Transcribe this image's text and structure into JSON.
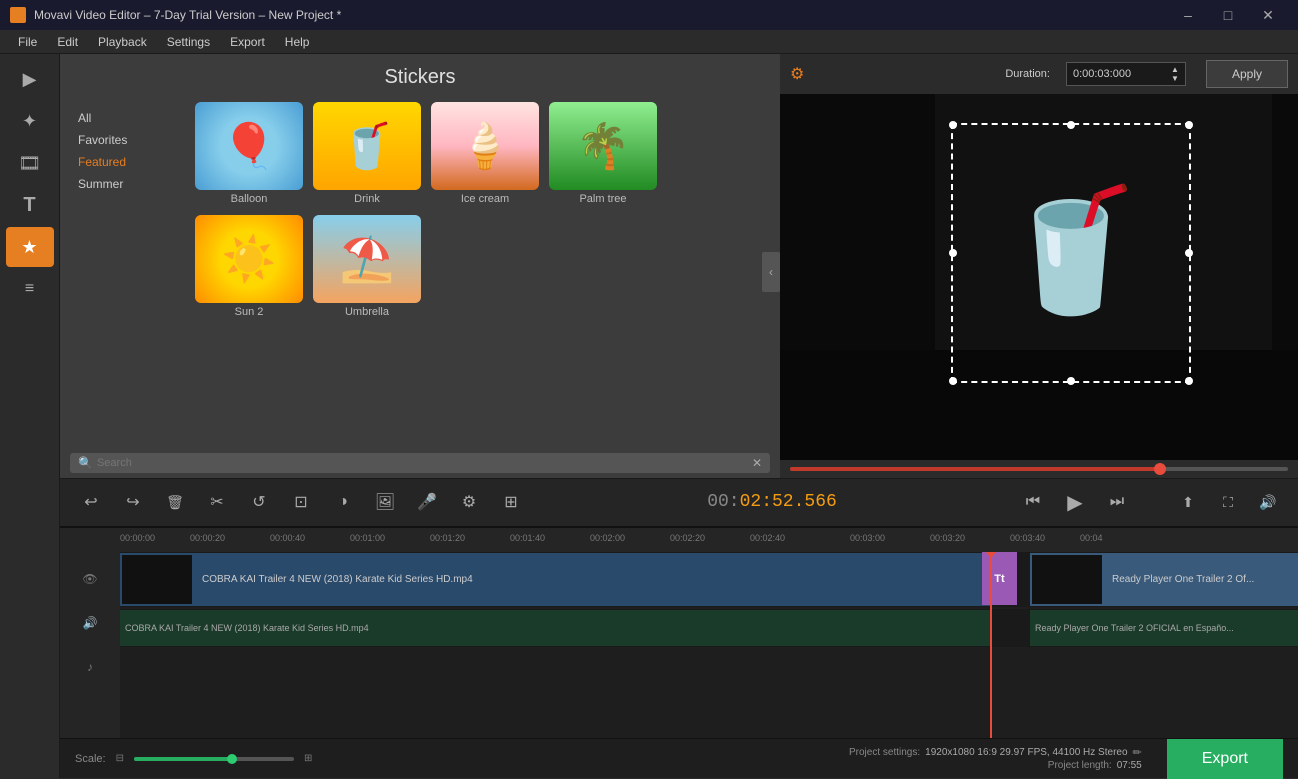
{
  "titlebar": {
    "title": "Movavi Video Editor – 7-Day Trial Version – New Project *",
    "icon": "M",
    "minimize": "–",
    "maximize": "□",
    "close": "✕"
  },
  "menubar": {
    "items": [
      "File",
      "Edit",
      "Playback",
      "Settings",
      "Export",
      "Help"
    ]
  },
  "stickers": {
    "header": "Stickers",
    "categories": [
      "All",
      "Favorites",
      "Featured",
      "Summer"
    ],
    "selected_category": "Featured",
    "items_row1": [
      {
        "name": "Balloon",
        "emoji": "🎈"
      },
      {
        "name": "Drink",
        "emoji": "🥤"
      },
      {
        "name": "Ice cream",
        "emoji": "🍦"
      },
      {
        "name": "Palm tree",
        "emoji": "🌴"
      }
    ],
    "items_row2": [
      {
        "name": "Sun 2",
        "emoji": "☀️"
      },
      {
        "name": "Umbrella",
        "emoji": "⛱️"
      }
    ],
    "search_placeholder": "Search"
  },
  "preview": {
    "gear_icon": "⚙",
    "duration_label": "Duration:",
    "duration_value": "0:00:03:000",
    "apply_label": "Apply"
  },
  "playback": {
    "timecode_prefix": "00:",
    "timecode_main": "02:52.566",
    "rewind_icon": "⏮",
    "play_icon": "▶",
    "forward_icon": "⏭",
    "undo_icon": "↩",
    "redo_icon": "↪",
    "delete_icon": "🗑",
    "cut_icon": "✂",
    "rotate_icon": "↺",
    "crop_icon": "⊡",
    "color_icon": "◑",
    "image_icon": "🖼",
    "audio_icon": "🎤",
    "settings_icon": "⚙",
    "filter_icon": "⊞",
    "export_icon": "⬆",
    "fullscreen_icon": "⛶",
    "volume_icon": "🔊"
  },
  "timeline": {
    "ruler_marks": [
      "00:00:00",
      "00:00:20",
      "00:00:40",
      "00:01:00",
      "00:01:20",
      "00:01:40",
      "00:02:00",
      "00:02:20",
      "00:02:40",
      "00:03:00",
      "00:03:20",
      "00:03:40",
      "00:04"
    ],
    "video_track_label1": "COBRA KAI Trailer 4 NEW (2018) Karate Kid Series HD.mp4",
    "video_track_label2": "Ready Player One   Trailer 2 Of...",
    "audio_track_label1": "COBRA KAI Trailer 4 NEW (2018) Karate Kid Series HD.mp4",
    "audio_track_label2": "Ready Player One   Trailer 2 OFICIAL en Españo..."
  },
  "bottom": {
    "scale_label": "Scale:",
    "project_settings_label": "Project settings:",
    "project_settings_value": "1920x1080  16:9  29.97 FPS, 44100 Hz Stereo",
    "project_length_label": "Project length:",
    "project_length_value": "07:55",
    "export_label": "Export",
    "edit_icon": "✏"
  }
}
